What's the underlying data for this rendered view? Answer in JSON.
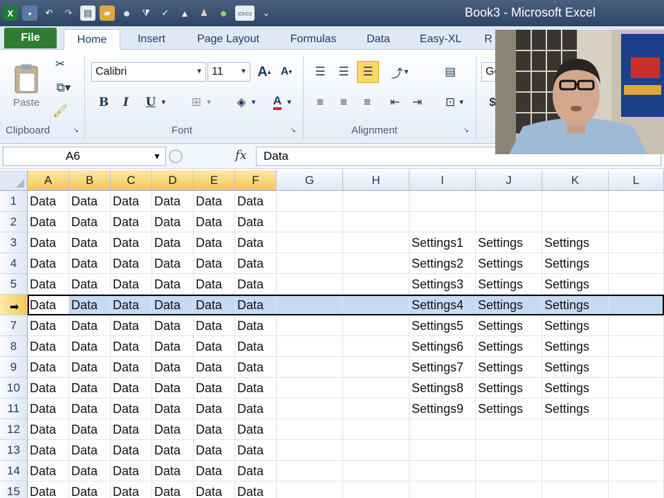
{
  "titlebar": {
    "app_title": "Book3 - Microsoft Excel",
    "qat_icons": [
      "excel-logo-icon",
      "save-icon",
      "undo-icon",
      "redo-icon",
      "print-preview-icon",
      "open-icon",
      "circle-icon",
      "filter-icon",
      "sort-icon",
      "mountain-icon",
      "person-icon",
      "green-ball-icon",
      "keyboard-icon",
      "customize-icon"
    ]
  },
  "tabs": [
    "File",
    "Home",
    "Insert",
    "Page Layout",
    "Formulas",
    "Data",
    "Easy-XL",
    "R"
  ],
  "ribbon": {
    "clipboard": {
      "paste_label": "Paste",
      "group_label": "Clipboard"
    },
    "font": {
      "font_name": "Calibri",
      "font_size": "11",
      "group_label": "Font",
      "bold": "B",
      "italic": "I",
      "underline": "U",
      "grow": "A",
      "shrink": "A",
      "font_color": "A"
    },
    "alignment": {
      "group_label": "Alignment"
    },
    "number": {
      "format_partial": "Ge",
      "currency": "$"
    }
  },
  "formula_bar": {
    "name_box": "A6",
    "fx": "fx",
    "formula": "Data"
  },
  "grid": {
    "columns": [
      "A",
      "B",
      "C",
      "D",
      "E",
      "F",
      "G",
      "H",
      "I",
      "J",
      "K",
      "L"
    ],
    "highlighted_columns": [
      "A",
      "B",
      "C",
      "D",
      "E",
      "F"
    ],
    "selected_row": 6,
    "rows": [
      {
        "n": "1",
        "cells": [
          "Data",
          "Data",
          "Data",
          "Data",
          "Data",
          "Data",
          "",
          "",
          "",
          "",
          ""
        ]
      },
      {
        "n": "2",
        "cells": [
          "Data",
          "Data",
          "Data",
          "Data",
          "Data",
          "Data",
          "",
          "",
          "",
          "",
          ""
        ]
      },
      {
        "n": "3",
        "cells": [
          "Data",
          "Data",
          "Data",
          "Data",
          "Data",
          "Data",
          "",
          "",
          "Settings1",
          "Settings",
          "Settings"
        ]
      },
      {
        "n": "4",
        "cells": [
          "Data",
          "Data",
          "Data",
          "Data",
          "Data",
          "Data",
          "",
          "",
          "Settings2",
          "Settings",
          "Settings"
        ]
      },
      {
        "n": "5",
        "cells": [
          "Data",
          "Data",
          "Data",
          "Data",
          "Data",
          "Data",
          "",
          "",
          "Settings3",
          "Settings",
          "Settings"
        ]
      },
      {
        "n": "6",
        "cells": [
          "Data",
          "Data",
          "Data",
          "Data",
          "Data",
          "Data",
          "",
          "",
          "Settings4",
          "Settings",
          "Settings"
        ]
      },
      {
        "n": "7",
        "cells": [
          "Data",
          "Data",
          "Data",
          "Data",
          "Data",
          "Data",
          "",
          "",
          "Settings5",
          "Settings",
          "Settings"
        ]
      },
      {
        "n": "8",
        "cells": [
          "Data",
          "Data",
          "Data",
          "Data",
          "Data",
          "Data",
          "",
          "",
          "Settings6",
          "Settings",
          "Settings"
        ]
      },
      {
        "n": "9",
        "cells": [
          "Data",
          "Data",
          "Data",
          "Data",
          "Data",
          "Data",
          "",
          "",
          "Settings7",
          "Settings",
          "Settings"
        ]
      },
      {
        "n": "10",
        "cells": [
          "Data",
          "Data",
          "Data",
          "Data",
          "Data",
          "Data",
          "",
          "",
          "Settings8",
          "Settings",
          "Settings"
        ]
      },
      {
        "n": "11",
        "cells": [
          "Data",
          "Data",
          "Data",
          "Data",
          "Data",
          "Data",
          "",
          "",
          "Settings9",
          "Settings",
          "Settings"
        ]
      },
      {
        "n": "12",
        "cells": [
          "Data",
          "Data",
          "Data",
          "Data",
          "Data",
          "Data",
          "",
          "",
          "",
          "",
          ""
        ]
      },
      {
        "n": "13",
        "cells": [
          "Data",
          "Data",
          "Data",
          "Data",
          "Data",
          "Data",
          "",
          "",
          "",
          "",
          ""
        ]
      },
      {
        "n": "14",
        "cells": [
          "Data",
          "Data",
          "Data",
          "Data",
          "Data",
          "Data",
          "",
          "",
          "",
          "",
          ""
        ]
      },
      {
        "n": "15",
        "cells": [
          "Data",
          "Data",
          "Data",
          "Data",
          "Data",
          "Data",
          "",
          "",
          "",
          "",
          ""
        ]
      }
    ]
  },
  "colors": {
    "title_bar": "#2d4565",
    "file_tab": "#2e7d32",
    "selection": "#c6dbf2",
    "header_highlight": "#f5c659"
  }
}
